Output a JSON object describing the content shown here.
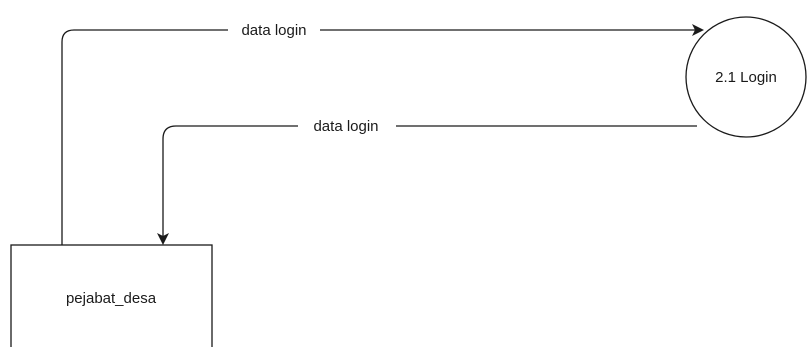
{
  "diagram": {
    "entity": {
      "label": "pejabat_desa"
    },
    "process": {
      "label": "2.1 Login"
    },
    "flows": [
      {
        "label": "data login",
        "from": "pejabat_desa",
        "to": "2.1 Login"
      },
      {
        "label": "data login",
        "from": "2.1 Login",
        "to": "pejabat_desa"
      }
    ],
    "colors": {
      "stroke": "#1a1a1a",
      "background": "#ffffff"
    }
  }
}
